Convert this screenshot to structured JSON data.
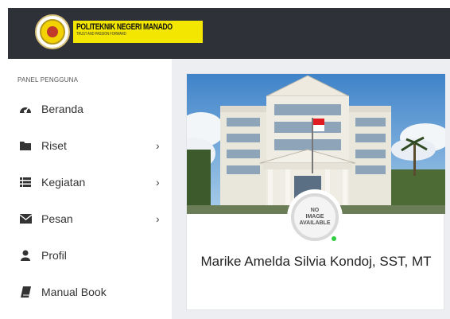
{
  "header": {
    "brand_name": "POLITEKNIK NEGERI MANADO",
    "brand_tagline": "TRUST AND PASSION FORWARD",
    "logo_icon": "institution-seal"
  },
  "sidebar": {
    "panel_title": "PANEL PENGGUNA",
    "items": [
      {
        "label": "Beranda",
        "icon": "dashboard-icon",
        "has_submenu": false
      },
      {
        "label": "Riset",
        "icon": "folder-icon",
        "has_submenu": true
      },
      {
        "label": "Kegiatan",
        "icon": "list-icon",
        "has_submenu": true
      },
      {
        "label": "Pesan",
        "icon": "envelope-icon",
        "has_submenu": true
      },
      {
        "label": "Profil",
        "icon": "user-icon",
        "has_submenu": false
      },
      {
        "label": "Manual Book",
        "icon": "book-icon",
        "has_submenu": false
      }
    ],
    "chevron": "›"
  },
  "profile_card": {
    "avatar_placeholder": "NO\nIMAGE\nAVAILABLE",
    "name": "Marike Amelda Silvia Kondoj, SST, MT",
    "status": "online"
  },
  "colors": {
    "header_bg": "#2e3138",
    "content_bg": "#eceef1",
    "brand_yellow": "#f3e600",
    "online": "#2ecc40"
  }
}
